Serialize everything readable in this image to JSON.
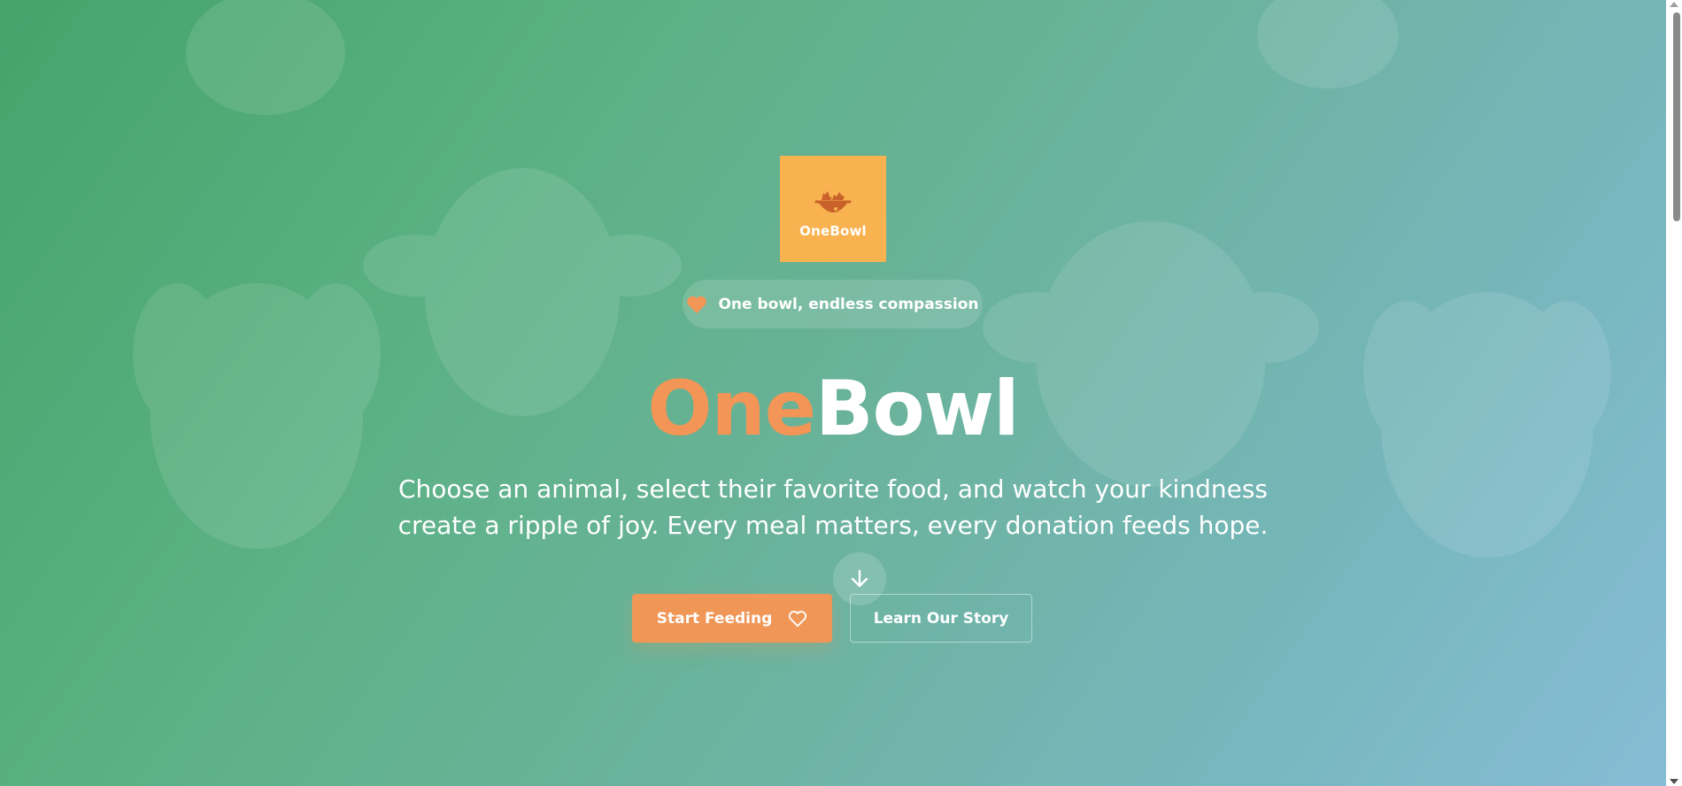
{
  "logo": {
    "text": "OneBowl",
    "icon": "animal-bowl-icon",
    "background": "#f8b24f"
  },
  "tagline": {
    "icon": "heart-icon",
    "text": "One bowl, endless compassion"
  },
  "hero": {
    "title_part1": "One",
    "title_part2": "Bowl",
    "title_accent_color": "#f39556",
    "subtitle_line1": "Choose an animal, select their favorite food, and watch your kindness",
    "subtitle_line2": "create a ripple of joy. Every meal matters, every donation feeds hope."
  },
  "scroll_indicator": {
    "icon": "arrow-down-icon"
  },
  "buttons": {
    "primary_label": "Start Feeding",
    "primary_icon": "heart-outline-icon",
    "primary_color": "#f09657",
    "secondary_label": "Learn Our Story"
  },
  "colors": {
    "gradient_start": "#45a46a",
    "gradient_end": "#86bdd6"
  }
}
